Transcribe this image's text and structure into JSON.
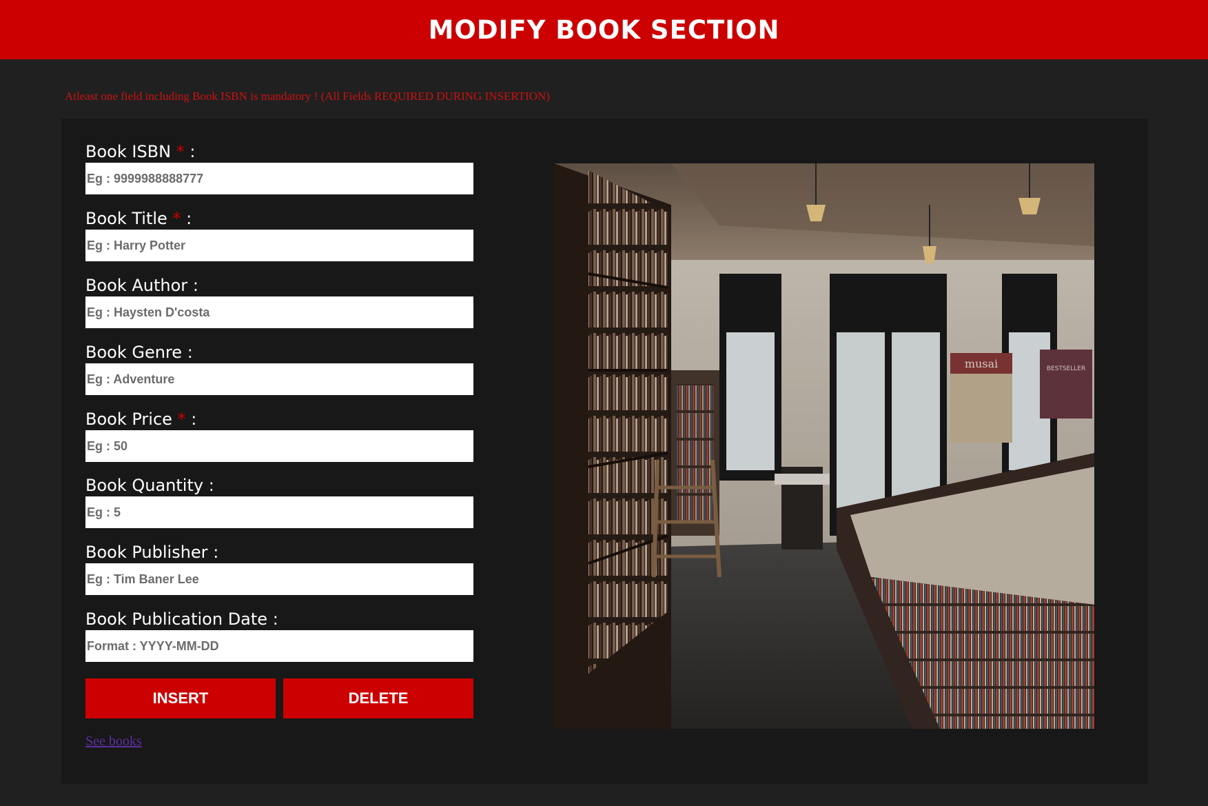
{
  "header": {
    "title": "MODIFY BOOK SECTION"
  },
  "notice": "Atleast one field including Book ISBN is mandatory ! (All Fields REQUIRED DURING INSERTION)",
  "form": {
    "fields": [
      {
        "label": "Book ISBN",
        "required": true,
        "placeholder": "Eg : 9999988888777",
        "value": ""
      },
      {
        "label": "Book Title",
        "required": true,
        "placeholder": "Eg : Harry Potter",
        "value": ""
      },
      {
        "label": "Book Author",
        "required": false,
        "placeholder": "Eg : Haysten D'costa",
        "value": ""
      },
      {
        "label": "Book Genre",
        "required": false,
        "placeholder": "Eg : Adventure",
        "value": ""
      },
      {
        "label": "Book Price",
        "required": true,
        "placeholder": "Eg : 50",
        "value": ""
      },
      {
        "label": "Book Quantity",
        "required": false,
        "placeholder": "Eg : 5",
        "value": ""
      },
      {
        "label": "Book Publisher",
        "required": false,
        "placeholder": "Eg : Tim Baner Lee",
        "value": ""
      },
      {
        "label": "Book Publication Date",
        "required": false,
        "placeholder": "Format : YYYY-MM-DD",
        "value": ""
      }
    ],
    "required_marker": "*",
    "separator": ":",
    "insert_label": "INSERT",
    "delete_label": "DELETE",
    "see_books_label": "See books"
  },
  "photo": {
    "sign_musai": "musai",
    "sign_bestseller": "BESTSELLER"
  },
  "colors": {
    "accent": "#cc0000",
    "background": "#202020",
    "panel": "#181818",
    "link": "#5b2ea0"
  }
}
